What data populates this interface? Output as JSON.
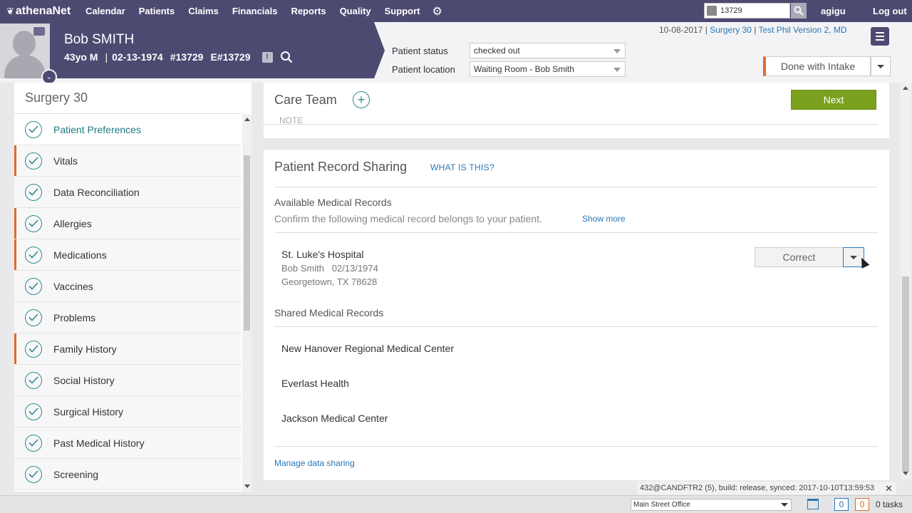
{
  "nav": {
    "brand": "athenaNet",
    "items": [
      "Calendar",
      "Patients",
      "Claims",
      "Financials",
      "Reports",
      "Quality",
      "Support"
    ],
    "search_value": "13729",
    "user": "agigu",
    "logout": "Log out"
  },
  "patient": {
    "name": "Bob SMITH",
    "age_sex": "43yo M",
    "dob": "02-13-1974",
    "id": "#13729",
    "eid": "E#13729",
    "alert": "!"
  },
  "status": {
    "status_label": "Patient status",
    "status_value": "checked out",
    "location_label": "Patient location",
    "location_value": "Waiting Room - Bob Smith"
  },
  "encounter": {
    "date": "10-08-2017",
    "dept": "Surgery 30",
    "provider": "Test Phil Version 2, MD",
    "done_label": "Done with Intake"
  },
  "sidebar": {
    "title": "Surgery 30",
    "items": [
      {
        "label": "Patient Preferences"
      },
      {
        "label": "Vitals"
      },
      {
        "label": "Data Reconciliation"
      },
      {
        "label": "Allergies"
      },
      {
        "label": "Medications"
      },
      {
        "label": "Vaccines"
      },
      {
        "label": "Problems"
      },
      {
        "label": "Family History"
      },
      {
        "label": "Social History"
      },
      {
        "label": "Surgical History"
      },
      {
        "label": "Past Medical History"
      },
      {
        "label": "Screening"
      }
    ]
  },
  "care_team": {
    "title": "Care Team",
    "next_label": "Next",
    "note_stub": "NOTE"
  },
  "sharing": {
    "title": "Patient Record Sharing",
    "what_link": "WHAT IS THIS?",
    "available_head": "Available Medical Records",
    "confirm_text": "Confirm the following medical record belongs to your patient.",
    "show_more": "Show more",
    "record": {
      "name": "St. Luke's Hospital",
      "patient_line": "Bob Smith   02/13/1974",
      "address_line": "Georgetown, TX 78628",
      "action_label": "Correct"
    },
    "shared_head": "Shared Medical Records",
    "shared": [
      "New Hanover Regional Medical Center",
      "Everlast Health",
      "Jackson Medical Center"
    ],
    "manage_link": "Manage data sharing"
  },
  "footer": {
    "build_info": "432@CANDFTR2 (5), build: release, synced: 2017-10-10T13:59:53",
    "office": "Main Street Office",
    "count_blue": "0",
    "count_orange": "0",
    "tasks": "0 tasks"
  },
  "colors": {
    "brand_purple": "#4d4a72",
    "accent_orange": "#e06a2a",
    "teal": "#2b8b90",
    "next_green": "#7aa01d",
    "link_blue": "#2a77b8"
  }
}
